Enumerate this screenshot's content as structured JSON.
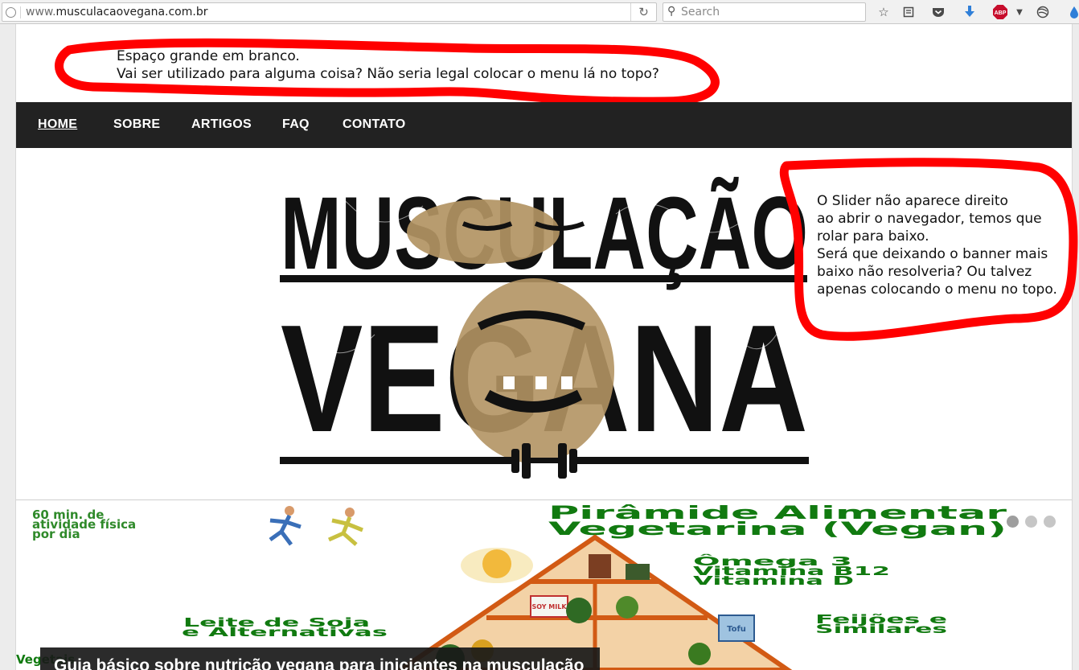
{
  "browser": {
    "url_prefix": "www.",
    "url_domain": "musculacaovegana.com.br",
    "search_placeholder": "Search",
    "toolbar_icons": [
      "globe-icon",
      "reload-icon",
      "search-icon",
      "bookmark-star-icon",
      "reading-list-icon",
      "pocket-icon",
      "download-icon",
      "adblock-plus-icon",
      "menu-dropdown-icon",
      "network-icon",
      "drop-icon"
    ],
    "adblock_label": "ABP"
  },
  "annotations": {
    "top_line1": "Espaço grande em branco.",
    "top_line2": "Vai ser utilizado para alguma coisa? Não seria legal colocar o menu lá no topo?",
    "right_line1": "O Slider não aparece direito",
    "right_line2": "ao abrir o navegador, temos que",
    "right_line3": "rolar para baixo.",
    "right_line4": "Será que deixando o banner mais",
    "right_line5": "baixo não resolveria? Ou talvez",
    "right_line6": "apenas colocando o menu no topo.",
    "highlight_color": "#ff0000"
  },
  "nav": {
    "items": [
      {
        "label": "HOME"
      },
      {
        "label": "SOBRE"
      },
      {
        "label": "ARTIGOS"
      },
      {
        "label": "FAQ"
      },
      {
        "label": "CONTATO"
      }
    ],
    "background": "#222222"
  },
  "logo": {
    "line1": "MUSCULAÇÃO",
    "line2": "VEGANA",
    "accent": "#b29463"
  },
  "slider": {
    "pyramid_title_line1": "Pirâmide Alimentar",
    "pyramid_title_line2": "Vegetarina (Vegan)",
    "activity_line1": "60 min. de",
    "activity_line2": "atividade física",
    "activity_line3": "por dia",
    "omega_line1": "Ômega 3",
    "omega_line2": "Vitamina B12",
    "omega_line3": "Vitamina D",
    "milk_line1": "Leite de Soja",
    "milk_line2": "e Alternativas",
    "beans_line1": "Feijões e",
    "beans_line2": "Similares",
    "veg_label": "Vegetais",
    "soy_label": "SOY MILK",
    "tofu_label": "Tofu",
    "caption": "Guia básico sobre nutrição vegana para iniciantes na musculação",
    "active_dot": 0
  }
}
